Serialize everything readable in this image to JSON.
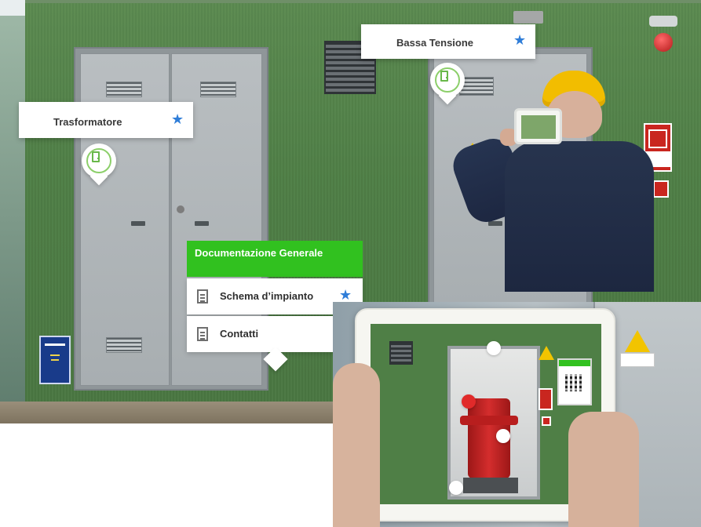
{
  "labels": {
    "bassa": {
      "text": "Bassa Tensione",
      "star": "★"
    },
    "trasformatore": {
      "text": "Trasformatore",
      "star": "★"
    }
  },
  "menu": {
    "header": "Documentazione Generale",
    "items": [
      {
        "label": "Schema d’impianto",
        "icon": "document-icon",
        "starred": true,
        "star": "★"
      },
      {
        "label": "Contatti",
        "icon": "document-icon",
        "starred": false
      }
    ]
  },
  "colors": {
    "accent_green": "#31c11f",
    "star_blue": "#2f7dd8",
    "wall_green": "#4f7f46"
  }
}
